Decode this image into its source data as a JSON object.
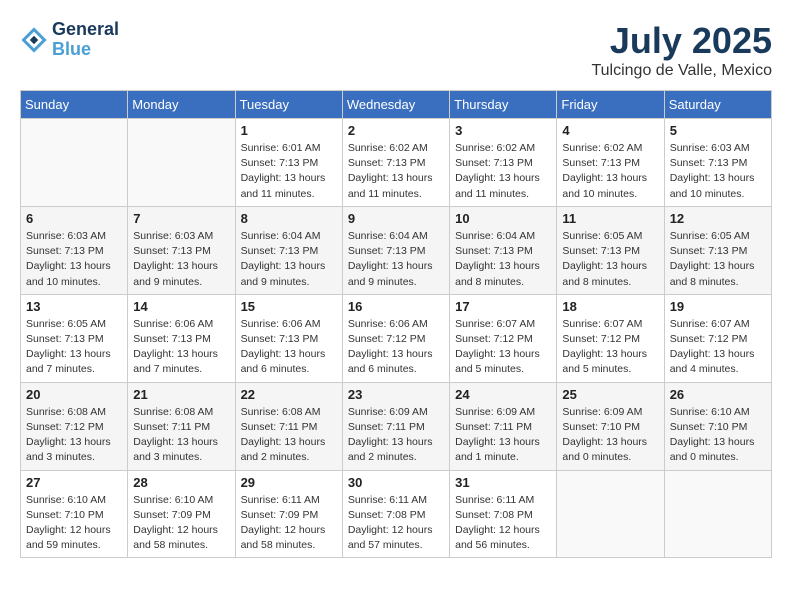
{
  "header": {
    "logo_line1": "General",
    "logo_line2": "Blue",
    "month": "July 2025",
    "location": "Tulcingo de Valle, Mexico"
  },
  "days_of_week": [
    "Sunday",
    "Monday",
    "Tuesday",
    "Wednesday",
    "Thursday",
    "Friday",
    "Saturday"
  ],
  "weeks": [
    [
      {
        "day": "",
        "detail": ""
      },
      {
        "day": "",
        "detail": ""
      },
      {
        "day": "1",
        "detail": "Sunrise: 6:01 AM\nSunset: 7:13 PM\nDaylight: 13 hours\nand 11 minutes."
      },
      {
        "day": "2",
        "detail": "Sunrise: 6:02 AM\nSunset: 7:13 PM\nDaylight: 13 hours\nand 11 minutes."
      },
      {
        "day": "3",
        "detail": "Sunrise: 6:02 AM\nSunset: 7:13 PM\nDaylight: 13 hours\nand 11 minutes."
      },
      {
        "day": "4",
        "detail": "Sunrise: 6:02 AM\nSunset: 7:13 PM\nDaylight: 13 hours\nand 10 minutes."
      },
      {
        "day": "5",
        "detail": "Sunrise: 6:03 AM\nSunset: 7:13 PM\nDaylight: 13 hours\nand 10 minutes."
      }
    ],
    [
      {
        "day": "6",
        "detail": "Sunrise: 6:03 AM\nSunset: 7:13 PM\nDaylight: 13 hours\nand 10 minutes."
      },
      {
        "day": "7",
        "detail": "Sunrise: 6:03 AM\nSunset: 7:13 PM\nDaylight: 13 hours\nand 9 minutes."
      },
      {
        "day": "8",
        "detail": "Sunrise: 6:04 AM\nSunset: 7:13 PM\nDaylight: 13 hours\nand 9 minutes."
      },
      {
        "day": "9",
        "detail": "Sunrise: 6:04 AM\nSunset: 7:13 PM\nDaylight: 13 hours\nand 9 minutes."
      },
      {
        "day": "10",
        "detail": "Sunrise: 6:04 AM\nSunset: 7:13 PM\nDaylight: 13 hours\nand 8 minutes."
      },
      {
        "day": "11",
        "detail": "Sunrise: 6:05 AM\nSunset: 7:13 PM\nDaylight: 13 hours\nand 8 minutes."
      },
      {
        "day": "12",
        "detail": "Sunrise: 6:05 AM\nSunset: 7:13 PM\nDaylight: 13 hours\nand 8 minutes."
      }
    ],
    [
      {
        "day": "13",
        "detail": "Sunrise: 6:05 AM\nSunset: 7:13 PM\nDaylight: 13 hours\nand 7 minutes."
      },
      {
        "day": "14",
        "detail": "Sunrise: 6:06 AM\nSunset: 7:13 PM\nDaylight: 13 hours\nand 7 minutes."
      },
      {
        "day": "15",
        "detail": "Sunrise: 6:06 AM\nSunset: 7:13 PM\nDaylight: 13 hours\nand 6 minutes."
      },
      {
        "day": "16",
        "detail": "Sunrise: 6:06 AM\nSunset: 7:12 PM\nDaylight: 13 hours\nand 6 minutes."
      },
      {
        "day": "17",
        "detail": "Sunrise: 6:07 AM\nSunset: 7:12 PM\nDaylight: 13 hours\nand 5 minutes."
      },
      {
        "day": "18",
        "detail": "Sunrise: 6:07 AM\nSunset: 7:12 PM\nDaylight: 13 hours\nand 5 minutes."
      },
      {
        "day": "19",
        "detail": "Sunrise: 6:07 AM\nSunset: 7:12 PM\nDaylight: 13 hours\nand 4 minutes."
      }
    ],
    [
      {
        "day": "20",
        "detail": "Sunrise: 6:08 AM\nSunset: 7:12 PM\nDaylight: 13 hours\nand 3 minutes."
      },
      {
        "day": "21",
        "detail": "Sunrise: 6:08 AM\nSunset: 7:11 PM\nDaylight: 13 hours\nand 3 minutes."
      },
      {
        "day": "22",
        "detail": "Sunrise: 6:08 AM\nSunset: 7:11 PM\nDaylight: 13 hours\nand 2 minutes."
      },
      {
        "day": "23",
        "detail": "Sunrise: 6:09 AM\nSunset: 7:11 PM\nDaylight: 13 hours\nand 2 minutes."
      },
      {
        "day": "24",
        "detail": "Sunrise: 6:09 AM\nSunset: 7:11 PM\nDaylight: 13 hours\nand 1 minute."
      },
      {
        "day": "25",
        "detail": "Sunrise: 6:09 AM\nSunset: 7:10 PM\nDaylight: 13 hours\nand 0 minutes."
      },
      {
        "day": "26",
        "detail": "Sunrise: 6:10 AM\nSunset: 7:10 PM\nDaylight: 13 hours\nand 0 minutes."
      }
    ],
    [
      {
        "day": "27",
        "detail": "Sunrise: 6:10 AM\nSunset: 7:10 PM\nDaylight: 12 hours\nand 59 minutes."
      },
      {
        "day": "28",
        "detail": "Sunrise: 6:10 AM\nSunset: 7:09 PM\nDaylight: 12 hours\nand 58 minutes."
      },
      {
        "day": "29",
        "detail": "Sunrise: 6:11 AM\nSunset: 7:09 PM\nDaylight: 12 hours\nand 58 minutes."
      },
      {
        "day": "30",
        "detail": "Sunrise: 6:11 AM\nSunset: 7:08 PM\nDaylight: 12 hours\nand 57 minutes."
      },
      {
        "day": "31",
        "detail": "Sunrise: 6:11 AM\nSunset: 7:08 PM\nDaylight: 12 hours\nand 56 minutes."
      },
      {
        "day": "",
        "detail": ""
      },
      {
        "day": "",
        "detail": ""
      }
    ]
  ]
}
